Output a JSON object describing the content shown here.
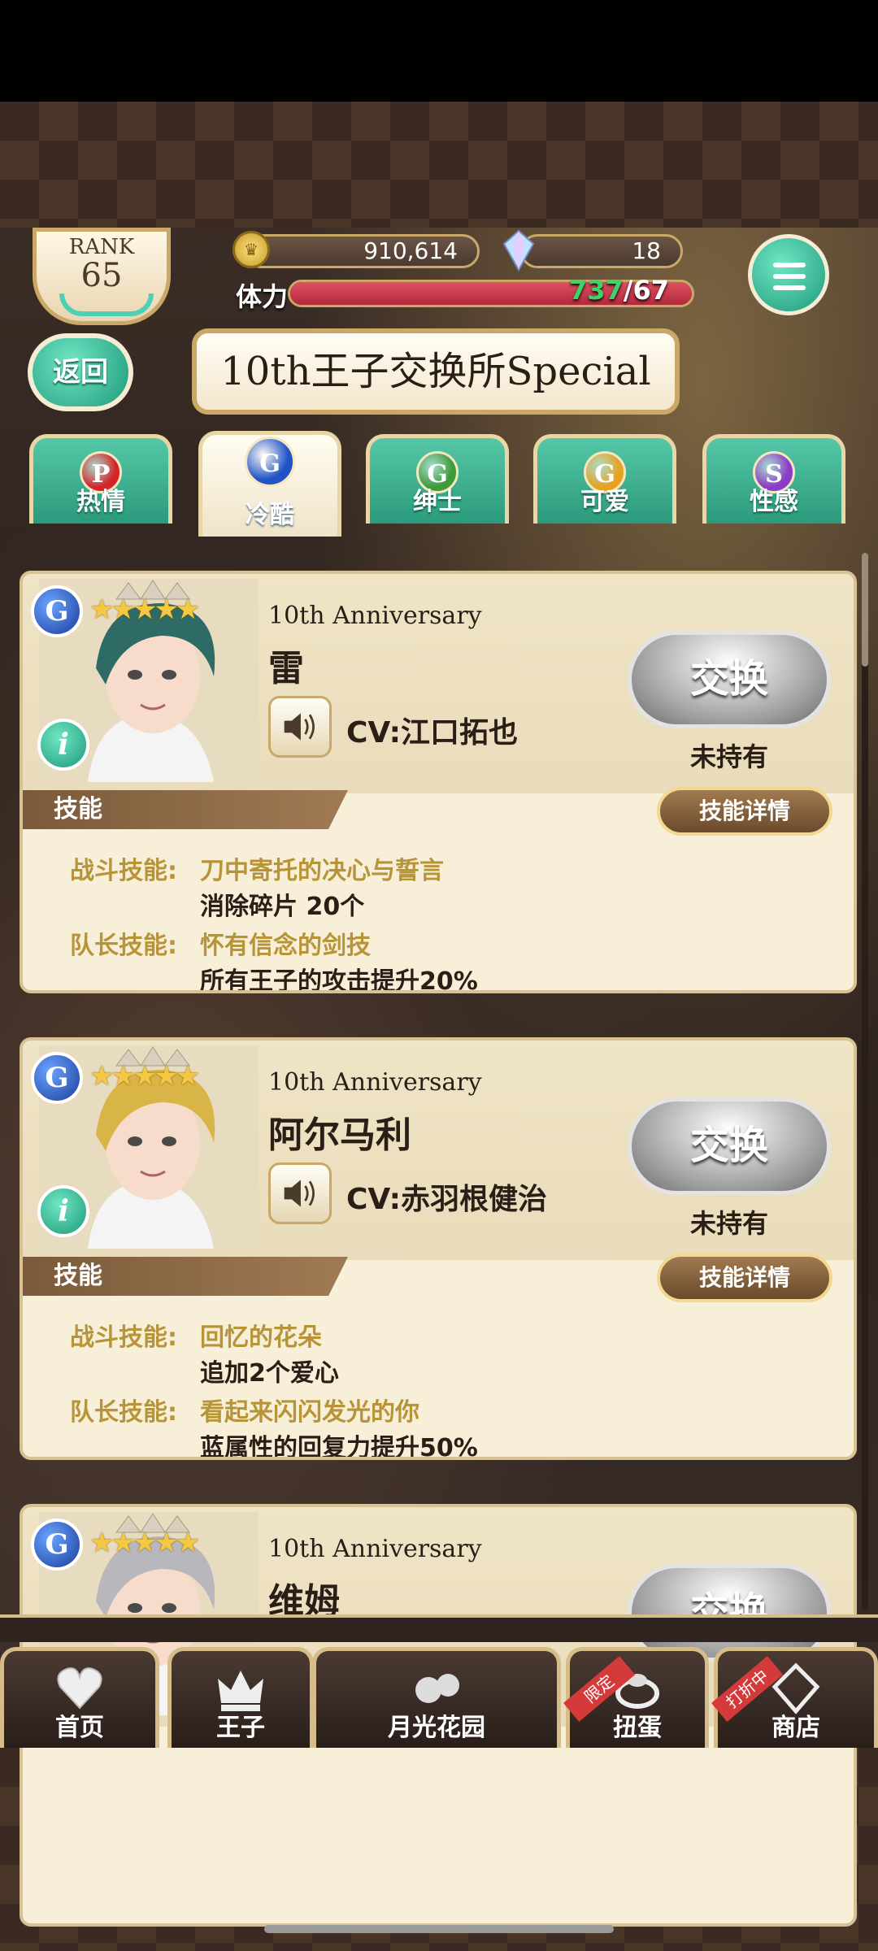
{
  "header": {
    "rank_label": "RANK",
    "rank_value": "65",
    "coins": "910,614",
    "gems": "18",
    "stamina_label": "体力",
    "stamina_current": "737",
    "stamina_max": "/67",
    "stamina_fill_fraction": 1.0
  },
  "back_label": "返回",
  "page_title": "10th王子交换所Special",
  "tabs": [
    {
      "orb": "P",
      "label": "热情",
      "color": "#d4242a",
      "active": false
    },
    {
      "orb": "G",
      "label": "冷酷",
      "color": "#1f53c6",
      "active": true
    },
    {
      "orb": "G",
      "label": "绅士",
      "color": "#3e9a3a",
      "active": false
    },
    {
      "orb": "G",
      "label": "可爱",
      "color": "#e6a21f",
      "active": false
    },
    {
      "orb": "S",
      "label": "性感",
      "color": "#8a3cc6",
      "active": false
    }
  ],
  "cards": [
    {
      "badge": "G",
      "stars": "★★★★★",
      "anniversary": "10th Anniversary",
      "name": "雷",
      "cv": "CV:江口拓也",
      "exchange_label": "交换",
      "owned_status": "未持有",
      "skill_header": "技能",
      "skill_detail_label": "技能详情",
      "battle_label": "战斗技能:",
      "battle_skill": "刀中寄托的决心与誓言",
      "battle_effect": "消除碎片 20个",
      "leader_label": "队长技能:",
      "leader_skill": "怀有信念的剑技",
      "leader_effect": "所有王子的攻击提升20%",
      "hair": "#2e6a66"
    },
    {
      "badge": "G",
      "stars": "★★★★★",
      "anniversary": "10th Anniversary",
      "name": "阿尔马利",
      "cv": "CV:赤羽根健治",
      "exchange_label": "交换",
      "owned_status": "未持有",
      "skill_header": "技能",
      "skill_detail_label": "技能详情",
      "battle_label": "战斗技能:",
      "battle_skill": "回忆的花朵",
      "battle_effect": "追加2个爱心",
      "leader_label": "队长技能:",
      "leader_skill": "看起来闪闪发光的你",
      "leader_effect": "蓝属性的回复力提升50%",
      "hair": "#d9b548"
    },
    {
      "badge": "G",
      "stars": "★★★★★",
      "anniversary": "10th Anniversary",
      "name": "维姆",
      "exchange_label": "交换",
      "hair": "#b8b8bc"
    }
  ],
  "nav": [
    {
      "label": "首页",
      "icon": "heart-icon"
    },
    {
      "label": "王子",
      "icon": "crown-icon"
    },
    {
      "label": "月光花园",
      "icon": "garden-icon"
    },
    {
      "label": "扭蛋",
      "icon": "ring-icon",
      "ribbon": "限定"
    },
    {
      "label": "商店",
      "icon": "gem-shop-icon",
      "ribbon": "打折中"
    }
  ]
}
